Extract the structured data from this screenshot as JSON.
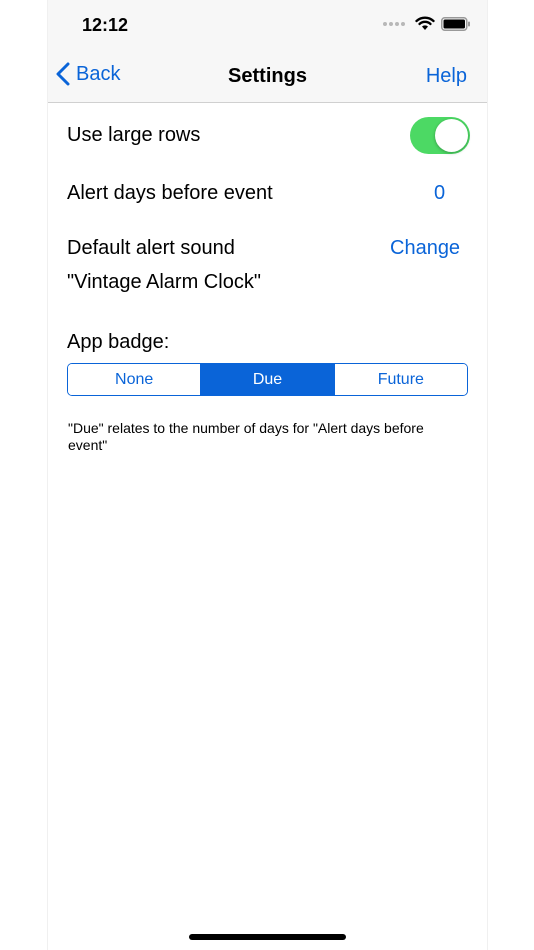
{
  "status_bar": {
    "time": "12:12"
  },
  "nav": {
    "back_label": "Back",
    "title": "Settings",
    "help_label": "Help"
  },
  "settings": {
    "large_rows_label": "Use large rows",
    "large_rows_enabled": true,
    "alert_days_label": "Alert days before event",
    "alert_days_value": "0",
    "alert_sound_label": "Default alert sound",
    "alert_sound_change": "Change",
    "alert_sound_value": "\"Vintage Alarm Clock\"",
    "app_badge_label": "App badge:",
    "app_badge_options": [
      "None",
      "Due",
      "Future"
    ],
    "app_badge_selected": "Due",
    "note": "\"Due\" relates to the number of days for \"Alert days before event\""
  },
  "colors": {
    "accent": "#0a64d8",
    "toggle_on": "#4cd964"
  }
}
